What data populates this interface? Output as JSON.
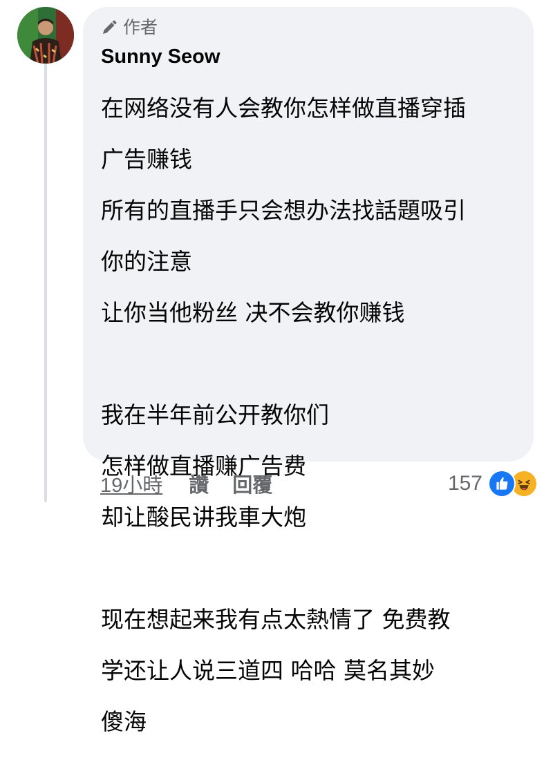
{
  "author": {
    "badge_label": "作者",
    "name": "Sunny Seow"
  },
  "comment": {
    "lines": [
      "在网络没有人会教你怎样做直播穿插",
      "广告赚钱",
      "所有的直播手只会想办法找話題吸引",
      "你的注意",
      "让你当他粉丝  决不会教你赚钱",
      "",
      "我在半年前公开教你们",
      "怎样做直播赚广告费",
      "却让酸民讲我車大炮",
      "",
      "现在想起来我有点太熱情了 免费教",
      "学还让人说三道四  哈哈 莫名其妙",
      "傻海"
    ]
  },
  "actions": {
    "timestamp": "19小時",
    "like_label": "讚",
    "reply_label": "回覆"
  },
  "reactions": {
    "count": "157",
    "types": [
      "like-icon",
      "haha-icon"
    ]
  },
  "colors": {
    "bubble": "#f0f2f5",
    "secondary_text": "#65676b",
    "like_blue": "#1877f2",
    "haha_yellow": "#f7b125"
  }
}
